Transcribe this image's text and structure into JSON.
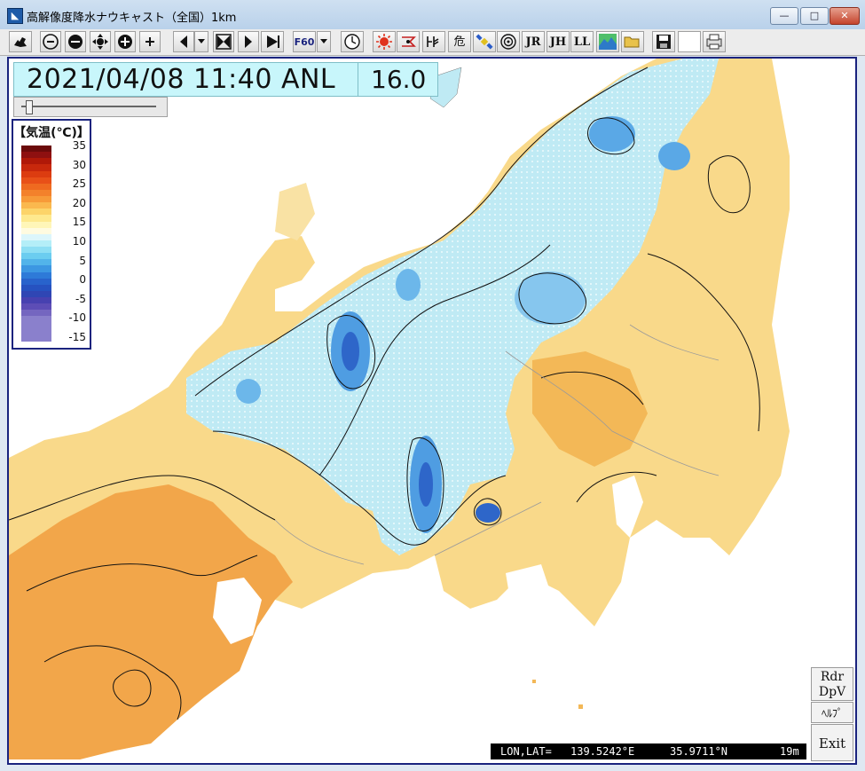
{
  "window": {
    "title": "高解像度降水ナウキャスト（全国）1km",
    "controls": {
      "minimize": "—",
      "maximize": "□",
      "close": "✕"
    }
  },
  "toolbar": {
    "f60_label": "F60",
    "danger_label": "危",
    "jr_label": "JR",
    "jh_label": "JH",
    "ll_label": "LL"
  },
  "map": {
    "datetime": "2021/04/08 11:40 ANL",
    "value": "16.0",
    "slider_position": 0.03
  },
  "legend": {
    "title": "【気温(℃)】",
    "ticks": [
      "35",
      "30",
      "25",
      "20",
      "15",
      "10",
      "5",
      "0",
      "-5",
      "-10",
      "-15"
    ],
    "colors": [
      "#6b0a0a",
      "#8e1010",
      "#b01808",
      "#c8280c",
      "#dc3c10",
      "#e85018",
      "#ef6a20",
      "#f3812b",
      "#f79a38",
      "#fab84e",
      "#fcd469",
      "#fee98e",
      "#fff6b8",
      "#fffbe0",
      "#dcf6fb",
      "#b4eef8",
      "#8edff4",
      "#6bcdf0",
      "#52b4ea",
      "#3c97e2",
      "#2e7ad8",
      "#2863cc",
      "#2652c0",
      "#2f46b4",
      "#4741b0",
      "#5d4db6",
      "#7466c0",
      "#8a80cc",
      "#8a80cc",
      "#8a80cc",
      "#8a80cc"
    ]
  },
  "side_buttons": {
    "rdr_line1": "Rdr",
    "rdr_line2": "DpV",
    "help": "ﾍﾙﾌﾟ",
    "exit": "Exit"
  },
  "status": {
    "lonlat_label": "LON,LAT=",
    "lon": "139.5242°E",
    "lat": "35.9711°N",
    "elev": "19m"
  }
}
